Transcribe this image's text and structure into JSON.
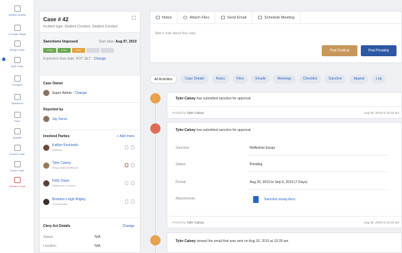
{
  "sidebar": {
    "items": [
      {
        "label": "Modify Details",
        "icon": "edit-icon",
        "red": false
      },
      {
        "label": "Change Stage",
        "icon": "stage-icon",
        "red": false
      },
      {
        "label": "Merge Case",
        "icon": "merge-icon",
        "red": false
      },
      {
        "label": "Split Case",
        "icon": "split-icon",
        "red": false
      },
      {
        "label": "Charges",
        "icon": "document-icon",
        "red": false
      },
      {
        "label": "Sanctions",
        "icon": "gavel-icon",
        "red": false
      },
      {
        "label": "Plea",
        "icon": "document-icon",
        "red": false
      },
      {
        "label": "Appeal",
        "icon": "hand-icon",
        "red": false
      },
      {
        "label": "Export Case",
        "icon": "export-icon",
        "red": false
      },
      {
        "label": "Close Case",
        "icon": "close-case-icon",
        "red": false
      },
      {
        "label": "Discard Case",
        "icon": "trash-icon",
        "red": true
      }
    ]
  },
  "case": {
    "title": "Case # 42",
    "incident_type": "Incident type: Student Conduct, Student Conduct",
    "sanctions": {
      "title": "Sanctions Imposed",
      "start_label": "Start date:",
      "start_date": "Aug 07, 2019",
      "pills": [
        {
          "label": "0 Days",
          "color": "#6aa84f"
        },
        {
          "label": "0 Days",
          "color": "#6aa84f"
        },
        {
          "label": "0 Days",
          "color": "#e0a341"
        },
        {
          "label": "",
          "color": "#d6d9de"
        },
        {
          "label": "",
          "color": "#d6d9de"
        }
      ],
      "expected_label": "Expected close date: NOT SET ·",
      "change": "Change"
    },
    "owner": {
      "label": "Case Owner",
      "name": "Super Admin -",
      "change": "Change"
    },
    "reported_by": {
      "label": "Reported by",
      "name": "Jay Sensi"
    },
    "involved": {
      "label": "Involved Parties",
      "add_more": "+ Add more",
      "people": [
        {
          "name": "Kaitlyn Kuchinski",
          "role": "Witness",
          "flag_red": false
        },
        {
          "name": "Tyler Calvey",
          "role": "Respondent/Offender",
          "flag_red": true
        },
        {
          "name": "Holly Davis",
          "role": "Student of Concern",
          "flag_red": false
        },
        {
          "name": "Brandon Leigh Wigley",
          "role": "Complainant",
          "flag_red": false
        }
      ]
    },
    "clery": {
      "title": "Clery Act Details",
      "change": "Change",
      "rows": [
        {
          "key": "Status",
          "value": "N/A"
        },
        {
          "key": "Location",
          "value": "N/A"
        }
      ]
    }
  },
  "note": {
    "tools": [
      "Notes",
      "Attach Files",
      "Send Email",
      "Schedule Meeting"
    ],
    "placeholder": "Add a note about this case",
    "post_publicly": "Post Publicly",
    "post_privately": "Post Privately"
  },
  "tabs": [
    "All Activities",
    "Case Details",
    "Notes",
    "Files",
    "Emails",
    "Meetings",
    "Checklist",
    "Sanction",
    "Appeal",
    "Log"
  ],
  "activities": [
    {
      "actor": "Tyler Calvey",
      "text": " has submitted sanction for approval",
      "posted_by": "Tyler Calvey",
      "date": "Aug 30, 2019 at 10:33 am",
      "dot_color": "#e8a24a"
    },
    {
      "actor": "Tyler Calvey",
      "text": " has submitted sanction for approval",
      "posted_by": "Tyler Calvey",
      "date": "Aug 30, 2019 at 10:33 am",
      "dot_color": "#e06b55",
      "fields": {
        "sanction_label": "Sanction:",
        "sanction": "Reflective Essay",
        "status_label": "Status:",
        "status": "Pending",
        "period_label": "Period:",
        "period": "Aug 30, 2019 to Sep 6, 2019 (7 Days)",
        "attachments_label": "Attachments:",
        "attachment": "Sanction essay.docx"
      }
    },
    {
      "actor": "Tyler Calvey",
      "text": " viewed the email that was sent on Aug 30, 2019 at 10:28 am",
      "dot_color": "#e8a24a"
    }
  ],
  "posted_prefix": "Posted by"
}
